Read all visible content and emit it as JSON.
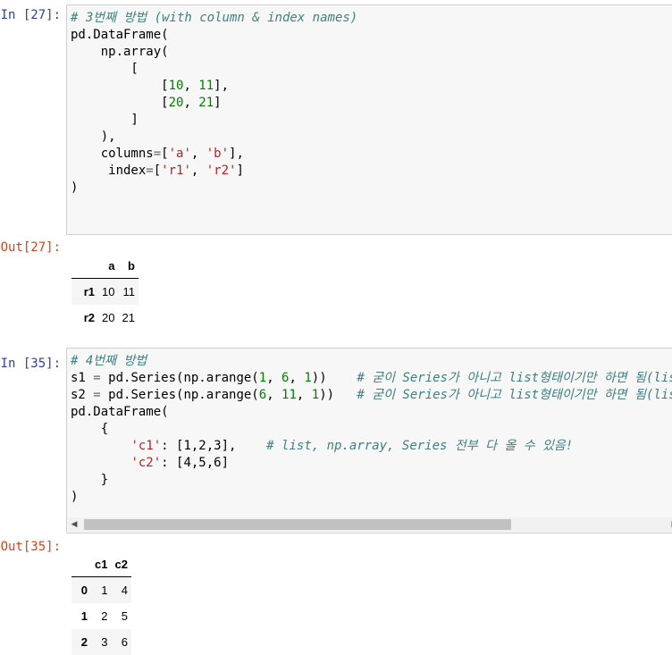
{
  "cells": [
    {
      "in_prompt": "In [27]:",
      "out_prompt": "Out[27]:",
      "table": {
        "columns": [
          "a",
          "b"
        ],
        "rows": [
          {
            "index": "r1",
            "values": [
              "10",
              "11"
            ]
          },
          {
            "index": "r2",
            "values": [
              "20",
              "21"
            ]
          }
        ]
      }
    },
    {
      "in_prompt": "In [35]:",
      "out_prompt": "Out[35]:",
      "table": {
        "columns": [
          "c1",
          "c2"
        ],
        "rows": [
          {
            "index": "0",
            "values": [
              "1",
              "4"
            ]
          },
          {
            "index": "1",
            "values": [
              "2",
              "5"
            ]
          },
          {
            "index": "2",
            "values": [
              "3",
              "6"
            ]
          }
        ]
      }
    }
  ],
  "code": {
    "c27": {
      "comment1": "# 3번째 방법 (with column & index names)",
      "l2": "pd.DataFrame(",
      "l3": "    np.array(",
      "l4": "        [",
      "l5_open": "            [",
      "n10": "10",
      "comma_sp": ", ",
      "n11": "11",
      "l5_close": "],",
      "l6_open": "            [",
      "n20": "20",
      "n21": "21",
      "l6_close": "]",
      "l7": "        ]",
      "l8": "    ),",
      "l9_pre": "    columns",
      "eq": "=",
      "l9_open": "[",
      "s_a": "'a'",
      "s_b": "'b'",
      "l9_close": "],",
      "l10_pre": "     index",
      "s_r1": "'r1'",
      "s_r2": "'r2'",
      "l10_close": "]",
      "l11": ")"
    },
    "c35": {
      "comment1": "# 4번째 방법",
      "s1_var": "s1 ",
      "s1_mid": " pd.Series(np.arange(",
      "n1": "1",
      "n6": "6",
      "close_paren2": "))",
      "sp4": "    ",
      "comment_series": "# 굳이 Series가 아니고 list형태이기만 하면 됨(list, np.array 가능)",
      "s2_var": "s2 ",
      "n11b": "11",
      "sp3": "   ",
      "l4": "pd.DataFrame(",
      "l5": "    {",
      "l6_indent": "        ",
      "s_c1": "'c1'",
      "colon": ": ",
      "l6_list": "[1,2,3],",
      "l6_sp": "    ",
      "comment_list": "# list, np.array, Series 전부 다 올 수 있음!",
      "s_c2": "'c2'",
      "l7_list": "[4,5,6]",
      "l8": "    }",
      "l9": ")"
    }
  },
  "scrollbar": {
    "left_arrow": "◀",
    "right_arrow": "▶"
  }
}
